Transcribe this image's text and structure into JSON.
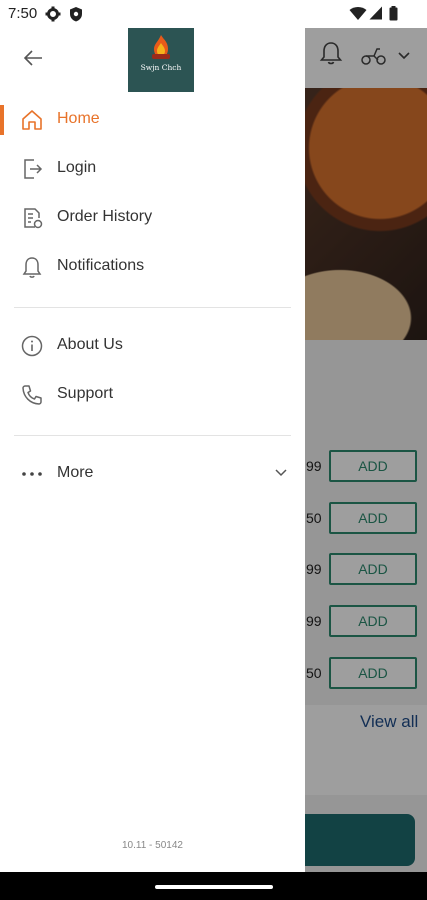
{
  "status_bar": {
    "time": "7:50"
  },
  "drawer": {
    "logo_text": "Swjn Chch",
    "items": [
      {
        "label": "Home",
        "icon": "home-icon",
        "active": true
      },
      {
        "label": "Login",
        "icon": "login-icon"
      },
      {
        "label": "Order History",
        "icon": "order-history-icon"
      },
      {
        "label": "Notifications",
        "icon": "bell-icon"
      },
      {
        "label": "About Us",
        "icon": "info-icon"
      },
      {
        "label": "Support",
        "icon": "phone-icon"
      },
      {
        "label": "More",
        "icon": "more-dots-icon"
      }
    ],
    "version": "10.11 - 50142"
  },
  "background": {
    "add_label": "ADD",
    "price_fragments": [
      "99",
      "50",
      "99",
      "99",
      "50"
    ],
    "view_all": "View all"
  },
  "colors": {
    "accent": "#e8732a",
    "teal": "#2c8a6e",
    "logo_bg": "#2c5453"
  }
}
